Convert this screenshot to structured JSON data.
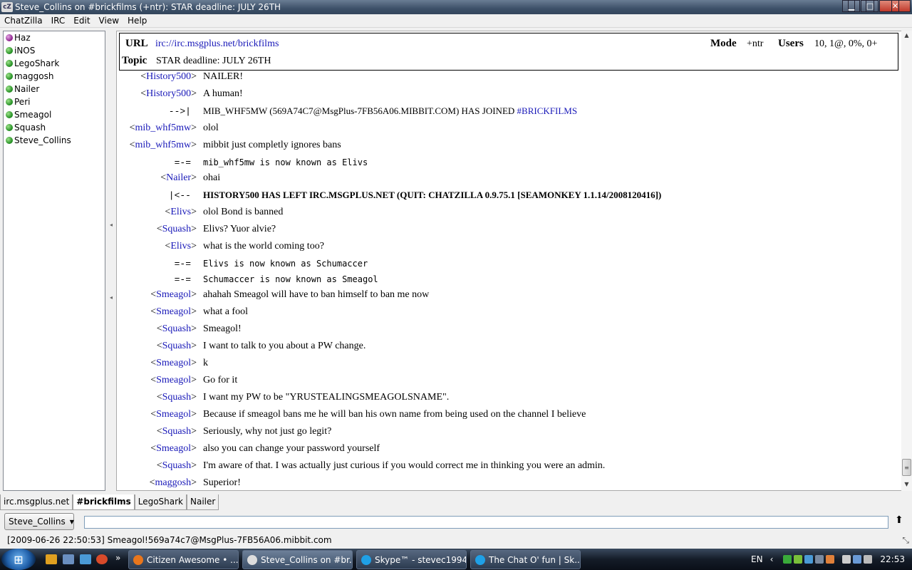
{
  "window": {
    "title": "Steve_Collins on #brickfilms (+ntr): STAR deadline: JULY 26TH",
    "app_icon": "cZ"
  },
  "menubar": [
    "ChatZilla",
    "IRC",
    "Edit",
    "View",
    "Help"
  ],
  "users": [
    {
      "name": "Haz",
      "op": true
    },
    {
      "name": "iNOS",
      "op": false
    },
    {
      "name": "LegoShark",
      "op": false
    },
    {
      "name": "maggosh",
      "op": false
    },
    {
      "name": "Nailer",
      "op": false
    },
    {
      "name": "Peri",
      "op": false
    },
    {
      "name": "Smeagol",
      "op": false
    },
    {
      "name": "Squash",
      "op": false
    },
    {
      "name": "Steve_Collins",
      "op": false
    }
  ],
  "header": {
    "url_label": "URL",
    "url": "irc://irc.msgplus.net/brickfilms",
    "mode_label": "Mode",
    "mode": "+ntr",
    "users_label": "Users",
    "users": "10, 1@, 0%, 0+",
    "topic_label": "Topic",
    "topic": "STAR deadline: JULY 26TH"
  },
  "messages": [
    {
      "type": "msg",
      "nick": "History500",
      "text": "NAILER!"
    },
    {
      "type": "msg",
      "nick": "History500",
      "text": "A human!"
    },
    {
      "type": "join",
      "marker": "-->|",
      "text": "MIB_WHF5MW (569A74C7@MsgPlus-7FB56A06.MIBBIT.COM) HAS JOINED ",
      "channel": "#BRICKFILMS"
    },
    {
      "type": "msg",
      "nick": "mib_whf5mw",
      "text": "olol"
    },
    {
      "type": "msg",
      "nick": "mib_whf5mw",
      "text": "mibbit just completly ignores bans"
    },
    {
      "type": "nickchange",
      "marker": "=-=",
      "text": "mib_whf5mw is now known as Elivs"
    },
    {
      "type": "msg",
      "nick": "Nailer",
      "text": "ohai"
    },
    {
      "type": "quit",
      "marker": "|<--",
      "text": "HISTORY500 HAS LEFT IRC.MSGPLUS.NET (QUIT: CHATZILLA 0.9.75.1 [SEAMONKEY 1.1.14/2008120416])"
    },
    {
      "type": "msg",
      "nick": "Elivs",
      "text": "olol Bond is banned"
    },
    {
      "type": "msg",
      "nick": "Squash",
      "text": "Elivs? Yuor alvie?"
    },
    {
      "type": "msg",
      "nick": "Elivs",
      "text": "what is the world coming too?"
    },
    {
      "type": "nickchange",
      "marker": "=-=",
      "text": "Elivs is now known as Schumaccer"
    },
    {
      "type": "nickchange",
      "marker": "=-=",
      "text": "Schumaccer is now known as Smeagol"
    },
    {
      "type": "msg",
      "nick": "Smeagol",
      "text": "ahahah Smeagol will have to ban himself to ban me now"
    },
    {
      "type": "msg",
      "nick": "Smeagol",
      "text": "what a fool"
    },
    {
      "type": "msg",
      "nick": "Squash",
      "text": "Smeagol!"
    },
    {
      "type": "msg",
      "nick": "Squash",
      "text": "I want to talk to you about a PW change."
    },
    {
      "type": "msg",
      "nick": "Smeagol",
      "text": "k"
    },
    {
      "type": "msg",
      "nick": "Smeagol",
      "text": "Go for it"
    },
    {
      "type": "msg",
      "nick": "Squash",
      "text": "I want my PW to be \"YRUSTEALINGSMEAGOLSNAME\"."
    },
    {
      "type": "msg",
      "nick": "Smeagol",
      "text": "Because if smeagol bans me he will ban his own name from being used on the channel I believe"
    },
    {
      "type": "msg",
      "nick": "Squash",
      "text": "Seriously, why not just go legit?"
    },
    {
      "type": "msg",
      "nick": "Smeagol",
      "text": "also you can change your password yourself"
    },
    {
      "type": "msg",
      "nick": "Squash",
      "text": "I'm aware of that. I was actually just curious if you would correct me in thinking you were an admin."
    },
    {
      "type": "msg",
      "nick": "maggosh",
      "text": "Superior!"
    }
  ],
  "tabs": [
    {
      "label": "irc.msgplus.net",
      "active": false
    },
    {
      "label": "#brickfilms",
      "active": true
    },
    {
      "label": "LegoShark",
      "active": false
    },
    {
      "label": "Nailer",
      "active": false
    }
  ],
  "input": {
    "nick": "Steve_Collins",
    "value": ""
  },
  "status": "[2009-06-26 22:50:53] Smeagol!569a74c7@MsgPlus-7FB56A06.mibbit.com",
  "taskbar": {
    "items": [
      {
        "label": "Citizen Awesome • ...",
        "color": "#e8761c",
        "active": false
      },
      {
        "label": "Steve_Collins on #br...",
        "color": "#dddddd",
        "active": true
      },
      {
        "label": "Skype™ - stevec1994",
        "color": "#1fa0e6",
        "active": false
      },
      {
        "label": "The Chat O' fun | Sk...",
        "color": "#1fa0e6",
        "active": false
      }
    ],
    "lang": "EN",
    "clock": "22:53"
  }
}
